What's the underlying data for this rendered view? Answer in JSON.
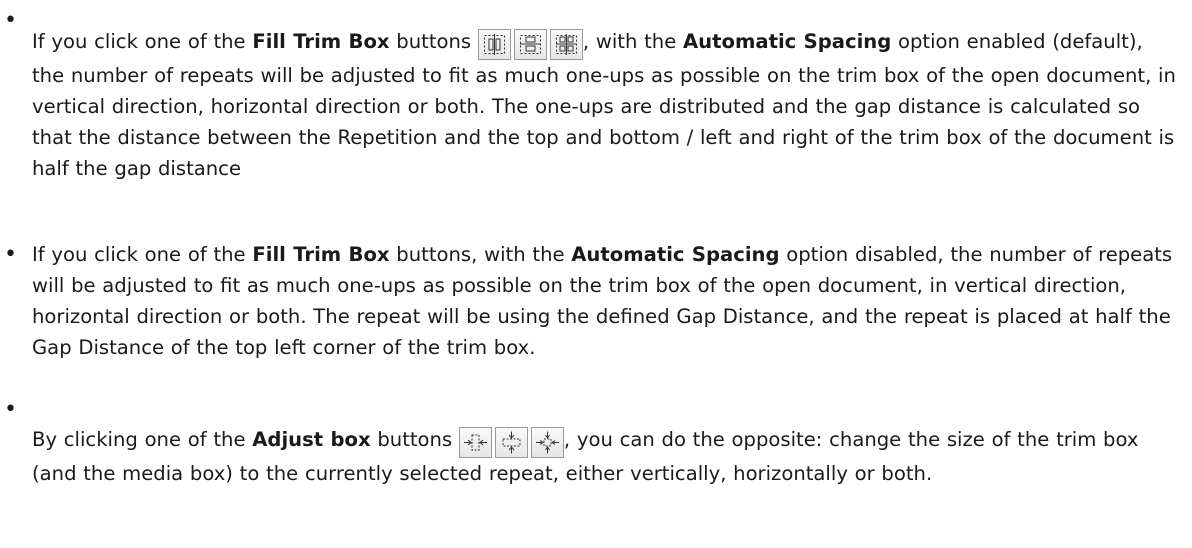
{
  "items": [
    {
      "p1": "If you click one of the ",
      "b1": "Fill Trim Box",
      "p2": " buttons ",
      "p3": ", with the ",
      "b2": "Automatic Spacing",
      "p4": " option enabled (default), the number of repeats will be adjusted to fit as much one-ups as possible on the trim box of the open document, in vertical direction, horizontal direction or both. The one-ups are distributed and the gap distance is calculated so that the distance between the Repetition and the top and bottom / left and right of the trim box of the document is half the gap distance",
      "buttons": [
        "fill-vertical-icon",
        "fill-horizontal-icon",
        "fill-both-icon"
      ]
    },
    {
      "p1": "If you click one of the ",
      "b1": "Fill Trim Box",
      "p2": " buttons, with the ",
      "b2": "Automatic Spacing",
      "p3": " option disabled, the number of repeats will be adjusted to fit as much one-ups as possible on the trim box of the open document, in vertical direction, horizontal direction or both. The repeat will be using the defined Gap Distance, and the repeat is placed at half the Gap Distance of the top left corner of the trim box."
    },
    {
      "p1": "By clicking one of the ",
      "b1": "Adjust box",
      "p2": " buttons ",
      "p3": ", you can do the opposite: change the size of the trim box (and the media box) to the currently selected repeat, either vertically, horizontally or both.",
      "buttons": [
        "adjust-vertical-icon",
        "adjust-horizontal-icon",
        "adjust-both-icon"
      ]
    }
  ],
  "bullet_glyph": "•",
  "colors": {
    "text": "#1a1a1a",
    "button_border": "#9a9a9a",
    "icon_stroke": "#333333"
  }
}
